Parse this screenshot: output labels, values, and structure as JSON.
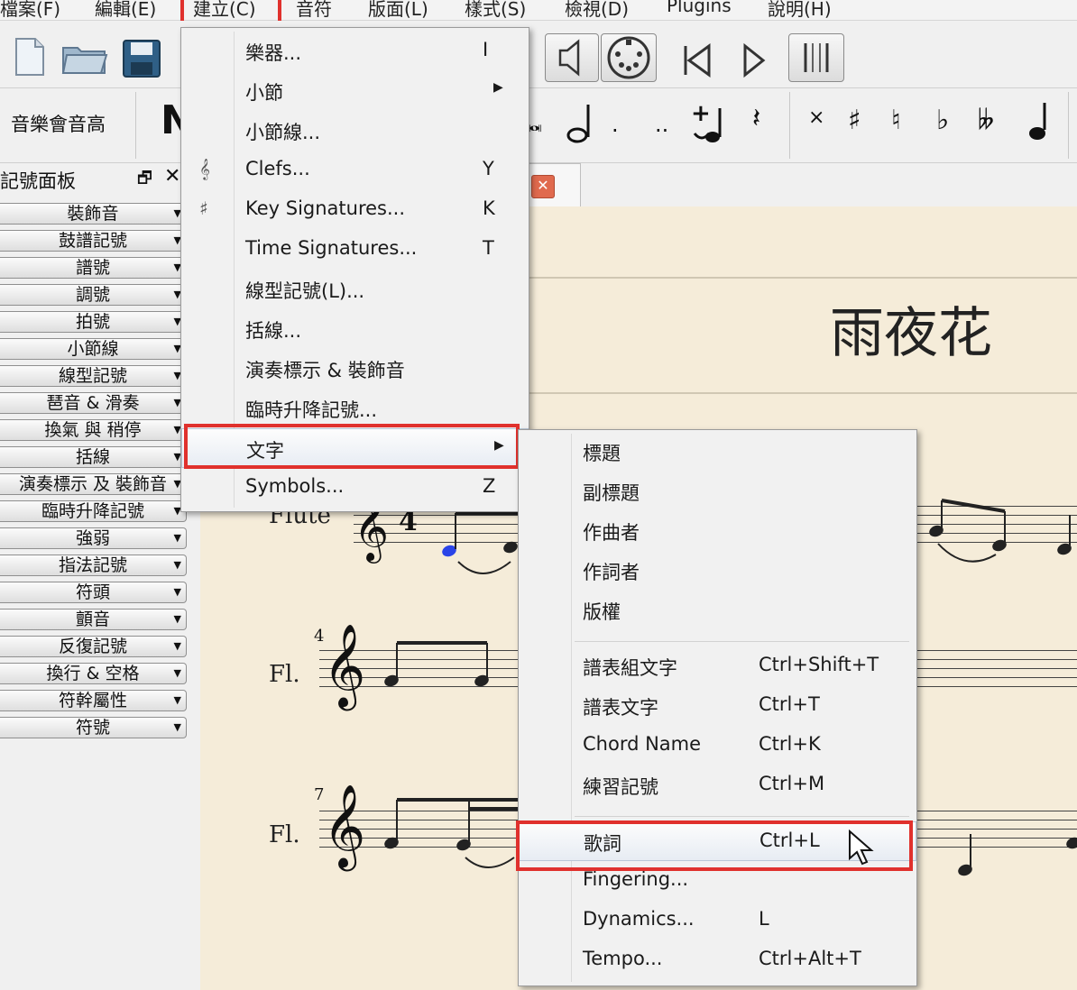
{
  "menubar": {
    "items": [
      "檔案(F)",
      "編輯(E)",
      "建立(C)",
      "音符",
      "版面(L)",
      "樣式(S)",
      "檢視(D)",
      "Plugins",
      "說明(H)"
    ]
  },
  "toolbar": {
    "note_input_label": "音樂會音高"
  },
  "palette": {
    "title": "記號面板",
    "items": [
      "裝飾音",
      "鼓譜記號",
      "譜號",
      "調號",
      "拍號",
      "小節線",
      "線型記號",
      "琶音 & 滑奏",
      "換氣 與 稍停",
      "括線",
      "演奏標示 及 裝飾音",
      "臨時升降記號",
      "強弱",
      "指法記號",
      "符頭",
      "顫音",
      "反復記號",
      "換行 & 空格",
      "符幹屬性",
      "符號"
    ]
  },
  "score": {
    "title": "雨夜花",
    "instrument_first": "Flute",
    "instrument_short": "Fl.",
    "measure_4": "4",
    "measure_7": "7"
  },
  "create_menu": {
    "items": [
      {
        "label": "樂器...",
        "shortcut": "I",
        "icon": "",
        "sub": false
      },
      {
        "label": "小節",
        "shortcut": "",
        "icon": "",
        "sub": true
      },
      {
        "label": "小節線...",
        "shortcut": "",
        "icon": "",
        "sub": false
      },
      {
        "label": "Clefs...",
        "shortcut": "Y",
        "icon": "𝄞",
        "sub": false
      },
      {
        "label": "Key Signatures...",
        "shortcut": "K",
        "icon": "♯",
        "sub": false
      },
      {
        "label": "Time Signatures...",
        "shortcut": "T",
        "icon": "",
        "sub": false
      },
      {
        "label": "線型記號(L)...",
        "shortcut": "",
        "icon": "",
        "sub": false
      },
      {
        "label": "括線...",
        "shortcut": "",
        "icon": "",
        "sub": false
      },
      {
        "label": "演奏標示 & 裝飾音",
        "shortcut": "",
        "icon": "",
        "sub": false
      },
      {
        "label": "臨時升降記號...",
        "shortcut": "",
        "icon": "",
        "sub": false
      },
      {
        "label": "文字",
        "shortcut": "",
        "icon": "",
        "sub": true
      },
      {
        "label": "Symbols...",
        "shortcut": "Z",
        "icon": "",
        "sub": false
      }
    ]
  },
  "text_submenu": {
    "group1": [
      "標題",
      "副標題",
      "作曲者",
      "作詞者",
      "版權"
    ],
    "group2": [
      {
        "label": "譜表組文字",
        "shortcut": "Ctrl+Shift+T"
      },
      {
        "label": "譜表文字",
        "shortcut": "Ctrl+T"
      },
      {
        "label": "Chord Name",
        "shortcut": "Ctrl+K"
      },
      {
        "label": "練習記號",
        "shortcut": "Ctrl+M"
      }
    ],
    "group3": [
      {
        "label": "歌詞",
        "shortcut": "Ctrl+L"
      },
      {
        "label": "Fingering...",
        "shortcut": ""
      },
      {
        "label": "Dynamics...",
        "shortcut": "L"
      },
      {
        "label": "Tempo...",
        "shortcut": "Ctrl+Alt+T"
      }
    ]
  }
}
